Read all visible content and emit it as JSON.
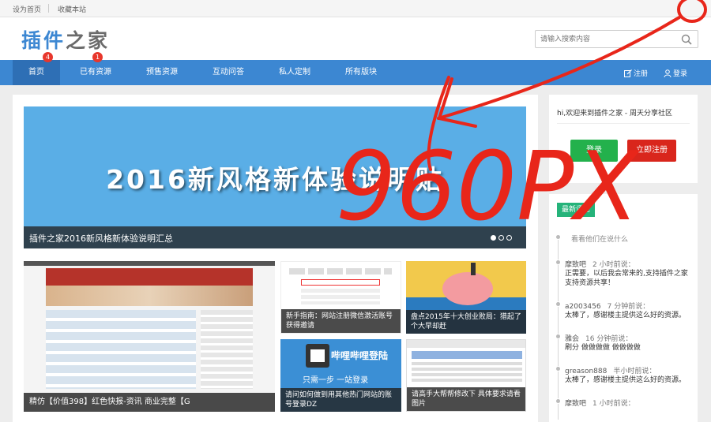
{
  "topbar": {
    "set_home": "设为首页",
    "bookmark": "收藏本站"
  },
  "header": {
    "logo_part1": "插件",
    "logo_part2": "之家",
    "search_placeholder": "请输入搜索内容"
  },
  "nav": {
    "items": [
      {
        "label": "首页",
        "badge": "4"
      },
      {
        "label": "已有资源",
        "badge": "1"
      },
      {
        "label": "预售资源"
      },
      {
        "label": "互动问答"
      },
      {
        "label": "私人定制"
      },
      {
        "label": "所有版块"
      }
    ],
    "register": "注册",
    "login": "登录"
  },
  "banner": {
    "headline": "2016新风格新体验说明贴",
    "caption": "插件之家2016新风格新体验说明汇总"
  },
  "thumbs": [
    {
      "caption": "精仿【价值398】红色快报-资讯 商业完整【G"
    },
    {
      "caption": "新手指南：网站注册微信激活账号获得邀请"
    },
    {
      "caption": "盘点2015年十大创业败局：猎起了个大早却赶"
    },
    {
      "caption": "请问如何做到用其他热门网站的账号登录DZ"
    },
    {
      "caption": "请高手大帮帮修改下 具体要求请看图片"
    }
  ],
  "thumb_art": {
    "bilibili_title": "哔哩哔哩登陆",
    "bilibili_sub": "只需一步 一站登录"
  },
  "sidebar": {
    "welcome": "hi,欢迎来到插件之家 - 周天分享社区",
    "login_button": "登录",
    "register_button": "立即注册",
    "comments_tag": "最新评论",
    "comments_intro": "看看他们在说什么",
    "comments": [
      {
        "user": "摩致吧",
        "time": "2 小时前说：",
        "text": "正需要，以后我会常来的,支持插件之家支持资源共享！"
      },
      {
        "user": "a2003456",
        "time": "7 分钟前说：",
        "text": "太棒了，感谢楼主提供这么好的资源。"
      },
      {
        "user": "雅会",
        "time": "16 分钟前说：",
        "text": "刷分 做做做做 做做做做"
      },
      {
        "user": "greason888",
        "time": "半小时前说：",
        "text": "太棒了，感谢楼主提供这么好的资源。"
      },
      {
        "user": "摩致吧",
        "time": "1 小时前说：",
        "text": ""
      }
    ]
  },
  "annotation": {
    "text": "960PX"
  },
  "colors": {
    "brand_blue": "#3c87d2",
    "login_green": "#23b14c",
    "register_red": "#d9261c",
    "annotation_red": "#e8261a"
  }
}
